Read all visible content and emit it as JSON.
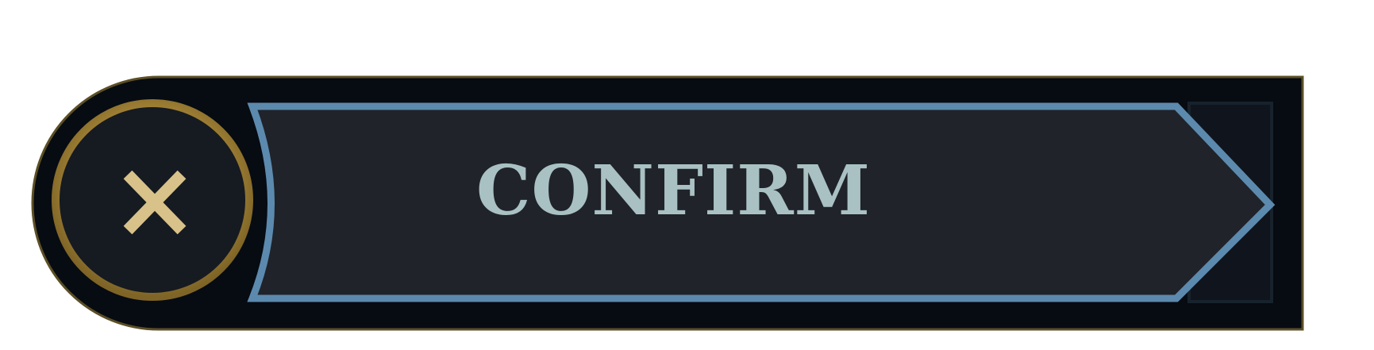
{
  "dialog": {
    "confirm_label": "CONFIRM",
    "close_glyph": "✕"
  },
  "icons": {
    "close": "close-icon",
    "arrow": "chevron-right-icon"
  },
  "colors": {
    "frame": "#070b12",
    "frame_edge": "#5c4f26",
    "gold": "#bf9d45",
    "gold_light": "#d8c28a",
    "button_fill": "#20232a",
    "button_edge": "#5c8aae",
    "label": "#a9c1c3"
  }
}
